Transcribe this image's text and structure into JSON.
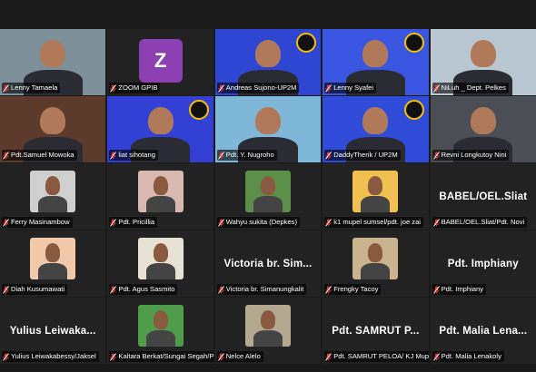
{
  "meeting": {
    "participants": [
      {
        "name": "Lenny Tamaela",
        "type": "video",
        "bg": "#7d8f98",
        "active": true
      },
      {
        "name": "ZOOM GPIB",
        "type": "avatar",
        "initial": "Z"
      },
      {
        "name": "Andreas Sujono-UP2M",
        "type": "video",
        "bg": "#2f46d2",
        "logo": true
      },
      {
        "name": "Lenny Syafei",
        "type": "video",
        "bg": "#3a55e0",
        "logo": true
      },
      {
        "name": "NiLuh _ Dept. Pelkes",
        "type": "video",
        "bg": "#b9c7d2"
      },
      {
        "name": "Pdt.Samuel Mowoka",
        "type": "video",
        "bg": "#5c3b2c"
      },
      {
        "name": "liat sihotang",
        "type": "video",
        "bg": "#3340d6",
        "logo": true
      },
      {
        "name": "Pdt. Y. Nugroho",
        "type": "video",
        "bg": "#7fb7d8"
      },
      {
        "name": "DaddyTherik / UP2M",
        "type": "video",
        "bg": "#2f4bd8",
        "logo": true
      },
      {
        "name": "Revni Longkutoy Nini",
        "type": "video",
        "bg": "#4b4f55"
      },
      {
        "name": "Ferry Masinambow",
        "type": "photo",
        "bg": "#cfcfcf"
      },
      {
        "name": "Pdt. Pricillia",
        "type": "photo",
        "bg": "#d9b8b0"
      },
      {
        "name": "Wahyu sukita (Depkes)",
        "type": "photo",
        "bg": "#5b8f4a"
      },
      {
        "name": "k1 mupel sumsel/pdt. joe zai",
        "type": "photo",
        "bg": "#f0c050"
      },
      {
        "name": "BABEL/OEL.Sliat/Pdt. Novi",
        "type": "text",
        "display": "BABEL/OEL.Sliat"
      },
      {
        "name": "Diah Kusumawati",
        "type": "photo",
        "bg": "#f2c9a8"
      },
      {
        "name": "Pdt. Agus Sasmito",
        "type": "photo",
        "bg": "#e8e2d4"
      },
      {
        "name": "Victoria br. Simanungkalit",
        "type": "text",
        "display": "Victoria br. Sim..."
      },
      {
        "name": "Frengky Tacoy",
        "type": "photo",
        "bg": "#c9b48e"
      },
      {
        "name": "Pdt. Imphiany",
        "type": "text",
        "display": "Pdt. Imphiany"
      },
      {
        "name": "Yulius Leiwakabessy/Jaksel",
        "type": "text",
        "display": "Yulius Leiwaka..."
      },
      {
        "name": "Kaltara Berkat/Sungai Segah/P...",
        "type": "photo",
        "bg": "#4f9c4a"
      },
      {
        "name": "Nelce Alelo",
        "type": "photo",
        "bg": "#b5a891"
      },
      {
        "name": "Pdt. SAMRUT PELOA/ KJ Mupel",
        "type": "text",
        "display": "Pdt. SAMRUT P..."
      },
      {
        "name": "Pdt. Malia Lenakoly",
        "type": "text",
        "display": "Pdt. Malia Lena..."
      }
    ]
  }
}
